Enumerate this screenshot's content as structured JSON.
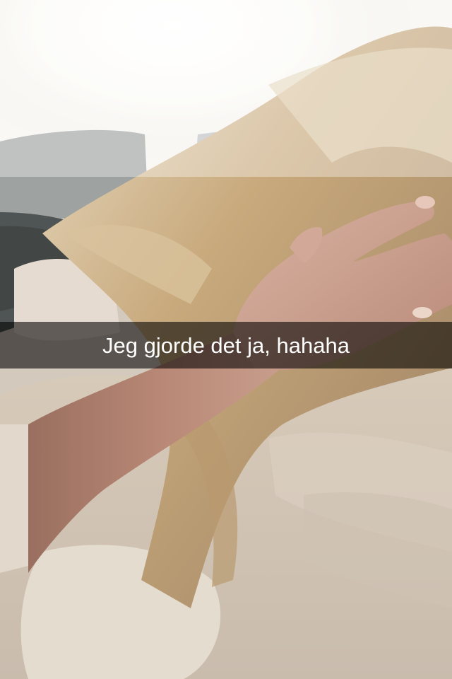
{
  "snap": {
    "caption": "Jeg gjorde det ja, hahaha"
  },
  "colors": {
    "caption_text": "#ffffff",
    "caption_bar": "rgba(0,0,0,0.58)",
    "hair": "#c9a978",
    "skin": "#c79a86",
    "fabric": "#d8cdbf",
    "pillow": "#8a8f8c",
    "window_light": "#fbfaf7"
  }
}
